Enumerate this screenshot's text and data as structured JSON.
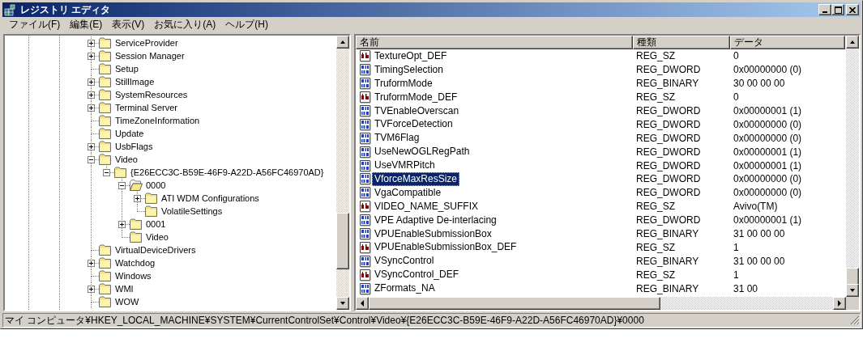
{
  "window": {
    "title": "レジストリ エディタ"
  },
  "menu": [
    {
      "label": "ファイル(F)"
    },
    {
      "label": "編集(E)"
    },
    {
      "label": "表示(V)"
    },
    {
      "label": "お気に入り(A)"
    },
    {
      "label": "ヘルプ(H)"
    }
  ],
  "tree": [
    {
      "label": "ServiceProvider",
      "expanded": false,
      "selected": false
    },
    {
      "label": "Session Manager",
      "expanded": false,
      "selected": false
    },
    {
      "label": "Setup",
      "selected": false
    },
    {
      "label": "StillImage",
      "expanded": false,
      "selected": false
    },
    {
      "label": "SystemResources",
      "expanded": false,
      "selected": false
    },
    {
      "label": "Terminal Server",
      "expanded": false,
      "selected": false
    },
    {
      "label": "TimeZoneInformation",
      "selected": false
    },
    {
      "label": "Update",
      "selected": false
    },
    {
      "label": "UsbFlags",
      "expanded": false,
      "selected": false
    },
    {
      "label": "Video",
      "expanded": true,
      "selected": false,
      "children": [
        {
          "label": "{E26ECC3C-B59E-46F9-A22D-A56FC46970AD}",
          "expanded": true,
          "selected": false,
          "children": [
            {
              "label": "0000",
              "expanded": true,
              "selected": true,
              "children": [
                {
                  "label": "ATI WDM Configurations",
                  "expanded": false,
                  "selected": false
                },
                {
                  "label": "VolatileSettings",
                  "selected": false
                }
              ]
            },
            {
              "label": "0001",
              "expanded": false,
              "selected": false
            },
            {
              "label": "Video",
              "selected": false
            }
          ]
        }
      ]
    },
    {
      "label": "VirtualDeviceDrivers",
      "selected": false
    },
    {
      "label": "Watchdog",
      "expanded": false,
      "selected": false
    },
    {
      "label": "Windows",
      "selected": false
    },
    {
      "label": "WMI",
      "expanded": false,
      "selected": false
    },
    {
      "label": "WOW",
      "selected": false
    }
  ],
  "values": {
    "columns": [
      "名前",
      "種類",
      "データ"
    ],
    "rows": [
      {
        "kind": "string",
        "name": "TextureOpt_DEF",
        "type": "REG_SZ",
        "data": "0",
        "selected": false
      },
      {
        "kind": "binary",
        "name": "TimingSelection",
        "type": "REG_DWORD",
        "data": "0x00000000 (0)",
        "selected": false
      },
      {
        "kind": "binary",
        "name": "TruformMode",
        "type": "REG_BINARY",
        "data": "30 00 00 00",
        "selected": false
      },
      {
        "kind": "string",
        "name": "TruformMode_DEF",
        "type": "REG_SZ",
        "data": "0",
        "selected": false
      },
      {
        "kind": "binary",
        "name": "TVEnableOverscan",
        "type": "REG_DWORD",
        "data": "0x00000001 (1)",
        "selected": false
      },
      {
        "kind": "binary",
        "name": "TVForceDetection",
        "type": "REG_DWORD",
        "data": "0x00000000 (0)",
        "selected": false
      },
      {
        "kind": "binary",
        "name": "TVM6Flag",
        "type": "REG_DWORD",
        "data": "0x00000000 (0)",
        "selected": false
      },
      {
        "kind": "binary",
        "name": "UseNewOGLRegPath",
        "type": "REG_DWORD",
        "data": "0x00000001 (1)",
        "selected": false
      },
      {
        "kind": "binary",
        "name": "UseVMRPitch",
        "type": "REG_DWORD",
        "data": "0x00000001 (1)",
        "selected": false
      },
      {
        "kind": "binary",
        "name": "VforceMaxResSize",
        "type": "REG_DWORD",
        "data": "0x00000000 (0)",
        "selected": true
      },
      {
        "kind": "binary",
        "name": "VgaCompatible",
        "type": "REG_DWORD",
        "data": "0x00000000 (0)",
        "selected": false
      },
      {
        "kind": "string",
        "name": "VIDEO_NAME_SUFFIX",
        "type": "REG_SZ",
        "data": "Avivo(TM)",
        "selected": false
      },
      {
        "kind": "binary",
        "name": "VPE Adaptive De-interlacing",
        "type": "REG_DWORD",
        "data": "0x00000001 (1)",
        "selected": false
      },
      {
        "kind": "binary",
        "name": "VPUEnableSubmissionBox",
        "type": "REG_BINARY",
        "data": "31 00 00 00",
        "selected": false
      },
      {
        "kind": "string",
        "name": "VPUEnableSubmissionBox_DEF",
        "type": "REG_SZ",
        "data": "1",
        "selected": false
      },
      {
        "kind": "binary",
        "name": "VSyncControl",
        "type": "REG_BINARY",
        "data": "31 00 00 00",
        "selected": false
      },
      {
        "kind": "string",
        "name": "VSyncControl_DEF",
        "type": "REG_SZ",
        "data": "1",
        "selected": false
      },
      {
        "kind": "binary",
        "name": "ZFormats_NA",
        "type": "REG_BINARY",
        "data": "31 00",
        "selected": false
      }
    ]
  },
  "status_bar": "マイ コンピュータ¥HKEY_LOCAL_MACHINE¥SYSTEM¥CurrentControlSet¥Control¥Video¥{E26ECC3C-B59E-46F9-A22D-A56FC46970AD}¥0000"
}
